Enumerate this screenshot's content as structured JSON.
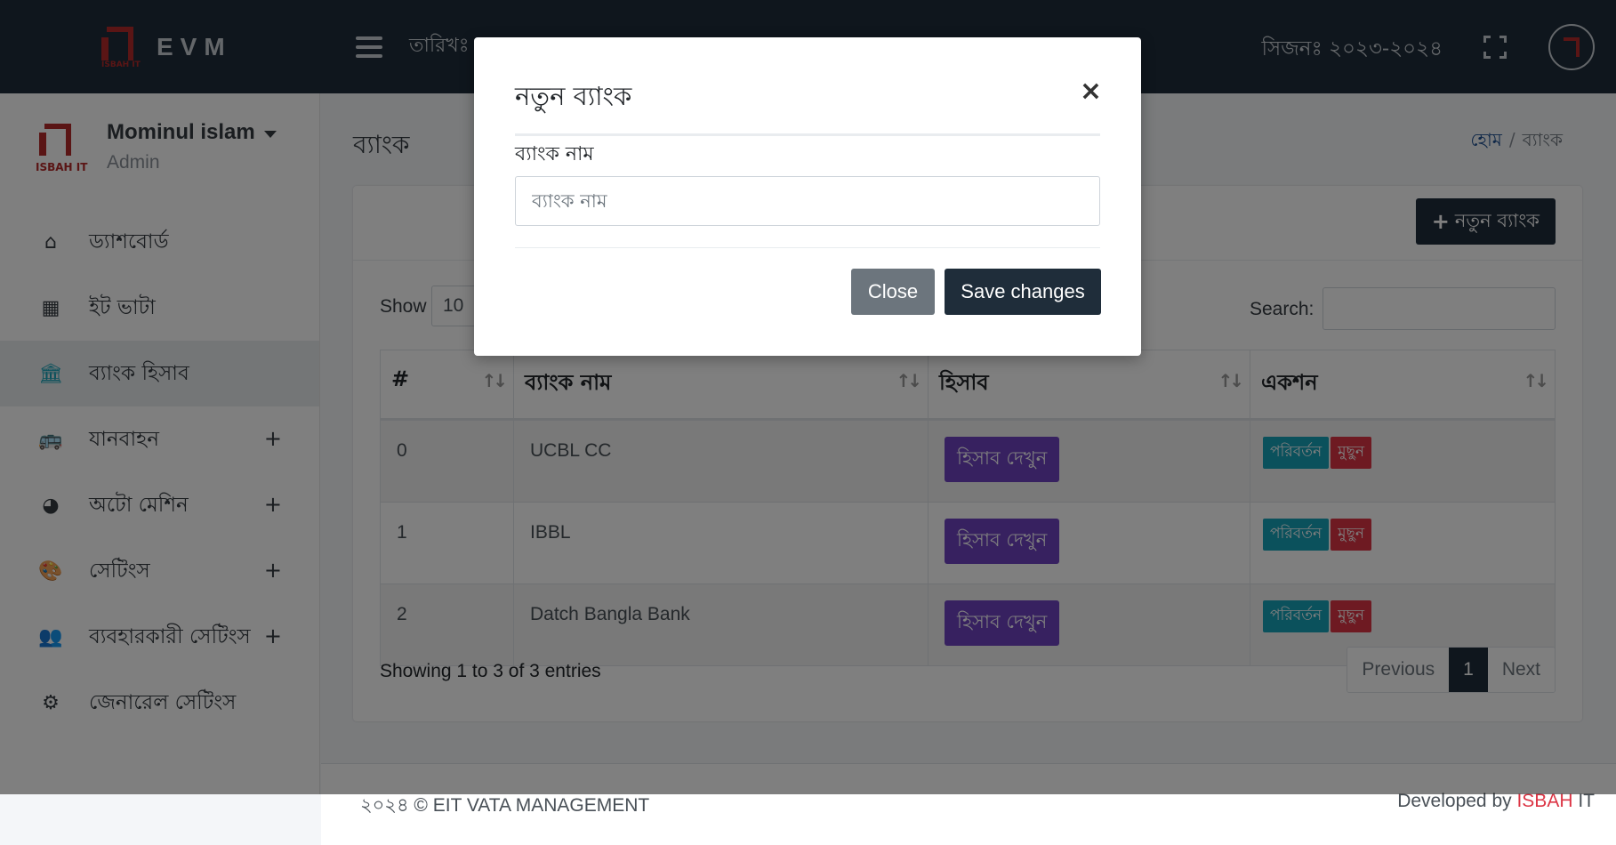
{
  "header": {
    "brand_text": "EVM",
    "logo_text": "ISBAH IT",
    "date_label": "তারিখঃ",
    "season": "সিজনঃ ২০২৩-২০২৪"
  },
  "sidebar": {
    "logo_text": "ISBAH IT",
    "user_name": "Mominul islam",
    "user_role": "Admin",
    "items": [
      {
        "label": "ড্যাশবোর্ড",
        "icon": "home-icon",
        "glyph": "⌂",
        "has_sub": false
      },
      {
        "label": "ইট ভাটা",
        "icon": "grid-icon",
        "glyph": "▦",
        "has_sub": false
      },
      {
        "label": "ব্যাংক হিসাব",
        "icon": "bank-icon",
        "glyph": "🏛",
        "has_sub": false,
        "active": true
      },
      {
        "label": "যানবাহন",
        "icon": "bus-icon",
        "glyph": "🚌",
        "has_sub": true
      },
      {
        "label": "অটো মেশিন",
        "icon": "gauge-icon",
        "glyph": "◕",
        "has_sub": true
      },
      {
        "label": "সেটিংস",
        "icon": "palette-icon",
        "glyph": "🎨",
        "has_sub": true
      },
      {
        "label": "ব্যবহারকারী সেটিংস",
        "icon": "users-icon",
        "glyph": "👥",
        "has_sub": true
      },
      {
        "label": "জেনারেল সেটিংস",
        "icon": "gear-icon",
        "glyph": "⚙",
        "has_sub": false
      }
    ],
    "plus_glyph": "+"
  },
  "content": {
    "page_title": "ব্যাংক",
    "breadcrumb_home": "হোম",
    "breadcrumb_sep": "/",
    "breadcrumb_current": "ব্যাংক",
    "new_button": "নতুন ব্যাংক",
    "show_label": "Show",
    "show_value": "10",
    "search_label": "Search:",
    "columns": [
      "#",
      "ব্যাংক নাম",
      "হিসাব",
      "একশন"
    ],
    "rows": [
      {
        "index": "0",
        "name": "UCBL CC",
        "view": "হিসাব দেখুন",
        "edit": "পরিবর্তন",
        "delete": "মুছুন"
      },
      {
        "index": "1",
        "name": "IBBL",
        "view": "হিসাব দেখুন",
        "edit": "পরিবর্তন",
        "delete": "মুছুন"
      },
      {
        "index": "2",
        "name": "Datch Bangla Bank",
        "view": "হিসাব দেখুন",
        "edit": "পরিবর্তন",
        "delete": "মুছুন"
      }
    ],
    "info": "Showing 1 to 3 of 3 entries",
    "pager": {
      "previous": "Previous",
      "current": "1",
      "next": "Next"
    }
  },
  "footer": {
    "left": "২০২৪ © EIT VATA MANAGEMENT",
    "right_prefix": "Developed by ",
    "right_brand": "ISBAH",
    "right_suffix": " IT"
  },
  "modal": {
    "title": "নতুন ব্যাংক",
    "close_glyph": "×",
    "field_label": "ব্যাংক নাম",
    "field_placeholder": "ব্যাংক নাম",
    "close_button": "Close",
    "save_button": "Save changes"
  },
  "colors": {
    "header_bg": "#1f2d3a",
    "brand_red": "#b52a2a",
    "view_button": "#6f42c1",
    "edit_button": "#17a2b8",
    "delete_button": "#dc3545"
  }
}
